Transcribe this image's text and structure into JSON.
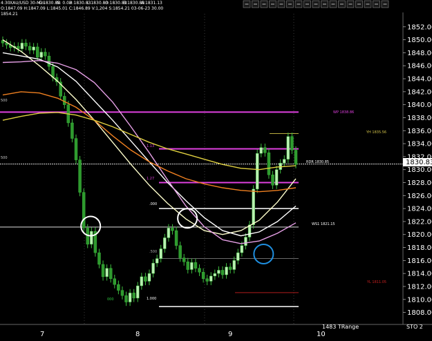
{
  "header": {
    "prefix": "4:30",
    "symbol": "XAU/USD 30-Min",
    "close": "C:1830.83",
    "net": "N: 0.02",
    "high": "H:1830.83",
    "low": "L:1830.83",
    "open": "O:1830.83",
    "bid": "B:1830.83",
    "ask": "A:1831.13",
    "line2": "O:1847.09 H:1847.09 L:1845.01 C:1846.89 V:1,204 S:1854.21 03-06-23 30.00",
    "line3": "1854.21"
  },
  "toolbar": {
    "icons": [
      "search-icon",
      "zoom-in-icon",
      "zoom-out-icon",
      "expand-icon",
      "line-icon",
      "text-icon",
      "grid-icon",
      "arrow-icon",
      "bell-icon",
      "lock-icon",
      "refresh-icon",
      "window-icon",
      "copy-icon",
      "list-icon",
      "cross-icon",
      "settings-icon",
      "close-icon"
    ]
  },
  "price_scale": {
    "labels": [
      "1852.00",
      "1850.00",
      "1848.00",
      "1846.00",
      "1844.00",
      "1842.00",
      "1840.00",
      "1838.00",
      "1836.00",
      "1834.00",
      "1832.00",
      "1830.00",
      "1828.00",
      "1826.00",
      "1824.00",
      "1822.00",
      "1820.00",
      "1818.00",
      "1816.00",
      "1814.00",
      "1812.00",
      "1810.00",
      "1808.00"
    ],
    "current_price": "1830.83"
  },
  "time_axis": {
    "labels": [
      "7",
      "8",
      "9",
      "10"
    ]
  },
  "annotations": {
    "wp": "WP 1838.86",
    "yh": "YH 1835.56",
    "rdr": "RDR 1830.85",
    "wsi": "WS1 1821.15",
    "yl": "YL 1811.05",
    "range": "1483 TRange",
    "fib_1": "1.000",
    "fib_000a": ".000",
    "fib_500": ".500",
    "fib_127": "1.27",
    "fib_000b": "000",
    "fib_13": "1.13",
    "left_a": "500",
    "left_b": "500",
    "bottom_right": "STO 2"
  },
  "chart_data": {
    "type": "candlestick",
    "symbol": "XAU/USD",
    "timeframe": "30-Min",
    "ylim": [
      1807,
      1854
    ],
    "x_tick_labels": [
      "7",
      "8",
      "9",
      "10"
    ],
    "price_levels": [
      {
        "label": "WP 1838.86",
        "value": 1838.86,
        "color": "#e040e0"
      },
      {
        "label": "YH 1835.56",
        "value": 1835.56,
        "color": "#d4c44a"
      },
      {
        "label": "1.13",
        "value": 1833.2,
        "color": "#e040e0"
      },
      {
        "label": "RDR 1830.85",
        "value": 1830.85,
        "color": "#ffffff"
      },
      {
        "label": "1.27",
        "value": 1828.0,
        "color": "#e040e0"
      },
      {
        "label": ".000",
        "value": 1824.0,
        "color": "#ffffff"
      },
      {
        "label": "WS1 1821.15",
        "value": 1821.15,
        "color": "#ffffff"
      },
      {
        "label": ".500",
        "value": 1816.3,
        "color": "#aaaaaa"
      },
      {
        "label": "YL 1811.05",
        "value": 1811.05,
        "color": "#cc2020"
      },
      {
        "label": "1.000",
        "value": 1808.9,
        "color": "#ffffff"
      }
    ],
    "close_series": [
      1849.5,
      1849.2,
      1848.8,
      1849.0,
      1848.6,
      1849.5,
      1849.0,
      1848.4,
      1848.9,
      1847.3,
      1848.1,
      1847.5,
      1845.9,
      1844.2,
      1843.5,
      1841.3,
      1840.0,
      1837.2,
      1834.8,
      1831.5,
      1826.5,
      1821.0,
      1818.5,
      1820.5,
      1817.2,
      1815.4,
      1813.5,
      1814.8,
      1813.2,
      1812.3,
      1811.4,
      1810.6,
      1809.6,
      1811.0,
      1810.2,
      1812.1,
      1813.5,
      1812.8,
      1814.0,
      1815.6,
      1816.3,
      1817.8,
      1819.5,
      1821.0,
      1820.6,
      1818.3,
      1816.4,
      1815.8,
      1814.6,
      1815.7,
      1814.8,
      1814.2,
      1813.2,
      1812.8,
      1813.6,
      1814.0,
      1814.5,
      1813.8,
      1815.0,
      1814.6,
      1816.0,
      1817.2,
      1818.3,
      1819.6,
      1821.5,
      1827.0,
      1832.5,
      1833.4,
      1832.6,
      1829.2,
      1827.6,
      1830.0,
      1831.0,
      1831.6,
      1835.1,
      1833.0,
      1830.8
    ],
    "moving_averages": [
      {
        "name": "MA1",
        "color": "#ffffcc",
        "values": [
          1850.0,
          1848.2,
          1846.0,
          1843.6,
          1840.8,
          1837.6,
          1834.2,
          1830.8,
          1827.6,
          1824.8,
          1822.4,
          1820.6,
          1820.0,
          1820.6,
          1822.2,
          1825.0,
          1828.6
        ]
      },
      {
        "name": "MA2",
        "color": "#ffffff",
        "values": [
          1848.0,
          1847.5,
          1847.0,
          1845.8,
          1843.6,
          1840.6,
          1837.6,
          1834.4,
          1831.2,
          1828.0,
          1825.2,
          1822.6,
          1820.6,
          1819.8,
          1820.4,
          1822.0,
          1824.4
        ]
      },
      {
        "name": "MA3",
        "color": "#e7a0e7",
        "values": [
          1846.5,
          1846.6,
          1846.8,
          1846.4,
          1845.4,
          1843.4,
          1840.4,
          1836.6,
          1832.6,
          1828.4,
          1824.4,
          1821.2,
          1819.2,
          1818.6,
          1819.0,
          1820.2,
          1821.8
        ]
      },
      {
        "name": "MA4",
        "color": "#f08020",
        "values": [
          1841.5,
          1842.0,
          1841.8,
          1841.0,
          1839.6,
          1837.6,
          1835.2,
          1833.0,
          1831.2,
          1829.8,
          1828.6,
          1827.8,
          1827.2,
          1826.8,
          1826.6,
          1826.8,
          1827.2
        ]
      },
      {
        "name": "MA5",
        "color": "#e0d040",
        "values": [
          1837.6,
          1838.2,
          1838.7,
          1838.8,
          1838.4,
          1837.6,
          1836.6,
          1835.4,
          1834.2,
          1833.2,
          1832.4,
          1831.6,
          1830.8,
          1830.2,
          1830.0,
          1830.4,
          1830.6
        ]
      }
    ],
    "indicator_circles": [
      {
        "x_fraction": 0.3,
        "price": 1821.3,
        "color": "#ffffff"
      },
      {
        "x_fraction": 0.63,
        "price": 1822.5,
        "color": "#ffffff"
      },
      {
        "x_fraction": 0.89,
        "price": 1817.0,
        "color": "#1f8fe0"
      }
    ]
  }
}
